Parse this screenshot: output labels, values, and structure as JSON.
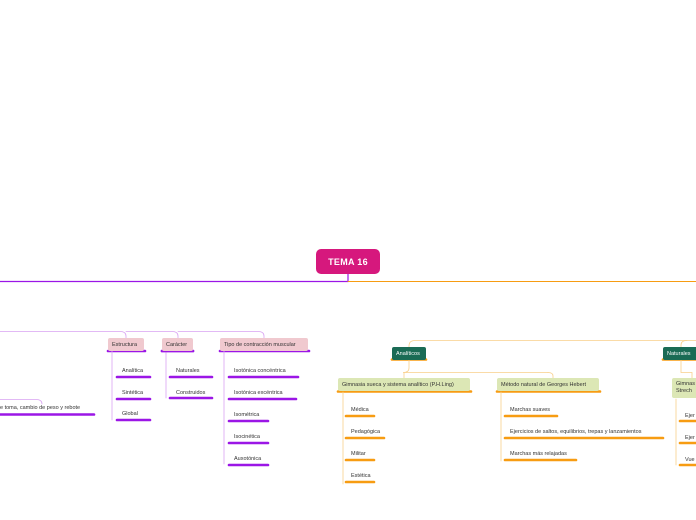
{
  "colors": {
    "root": "#d6187d",
    "purple": "#9b16e6",
    "light_purple": "#d9a3f2",
    "orange": "#f79c12",
    "light_orange": "#f9cf8a",
    "teal": "#1a6b55",
    "pink_label": "#f0c9cf",
    "light_green_label": "#dce7b5"
  },
  "root": {
    "label": "TEMA 16"
  },
  "left_branch": {
    "partial_leaf": "e toma, cambio de peso y rebote",
    "structure": {
      "label": "Estructura",
      "items": [
        "Analítica",
        "Sintética",
        "Global"
      ]
    },
    "character": {
      "label": "Carácter",
      "items": [
        "Naturales",
        "Construidos"
      ]
    },
    "contraction": {
      "label": "Tipo de contracción muscular",
      "items": [
        "Isotónica concéntrica",
        "Isotónica excéntrica",
        "Isométrica",
        "Isocinética",
        "Auxotónica"
      ]
    }
  },
  "right_branch": {
    "analiticos": {
      "label": "Analíticos",
      "sueca": {
        "label": "Gimnasia sueca y sistema analítico (P.H.Ling)",
        "items": [
          "Médica",
          "Pedagógica",
          "Militar",
          "Estética"
        ]
      },
      "hebert": {
        "label": "Método natural de Georges Hebert",
        "items": [
          "Marchas suaves",
          "Ejercicios de saltos, equilibrios, trepas y lanzamientos",
          "Marchas más relajadas"
        ]
      }
    },
    "naturales": {
      "label": "Naturales",
      "partial_node": {
        "line1": "Gimnas",
        "line2": "Strech"
      },
      "partial_items": [
        "Ejer",
        "Ejer",
        "Vue"
      ]
    }
  }
}
